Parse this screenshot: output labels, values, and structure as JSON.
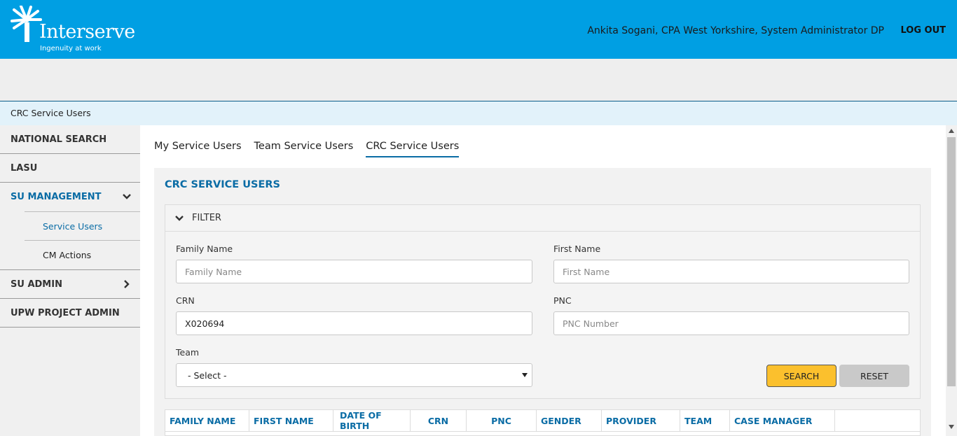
{
  "brand": {
    "name": "Interserve",
    "tagline": "Ingenuity at work"
  },
  "header": {
    "user": "Ankita Sogani, CPA West Yorkshire, System Administrator DP",
    "logout_label": "LOG OUT"
  },
  "breadcrumb": "CRC Service Users",
  "sidebar": {
    "national_search": "NATIONAL SEARCH",
    "lasu": "LASU",
    "su_management": "SU MANAGEMENT",
    "service_users": "Service Users",
    "cm_actions": "CM Actions",
    "su_admin": "SU ADMIN",
    "upw_project_admin": "UPW PROJECT ADMIN"
  },
  "tabs": {
    "my": "My Service Users",
    "team": "Team Service Users",
    "crc": "CRC Service Users"
  },
  "panel": {
    "title": "CRC SERVICE USERS",
    "filter_label": "FILTER"
  },
  "form": {
    "family_name": {
      "label": "Family Name",
      "placeholder": "Family Name",
      "value": ""
    },
    "first_name": {
      "label": "First Name",
      "placeholder": "First Name",
      "value": ""
    },
    "crn": {
      "label": "CRN",
      "placeholder": "",
      "value": "X020694"
    },
    "pnc": {
      "label": "PNC",
      "placeholder": "PNC Number",
      "value": ""
    },
    "team": {
      "label": "Team",
      "selected": "- Select -"
    },
    "search_label": "SEARCH",
    "reset_label": "RESET"
  },
  "table": {
    "columns": {
      "family_name": "FAMILY NAME",
      "first_name": "FIRST NAME",
      "dob": "DATE OF BIRTH",
      "crn": "CRN",
      "pnc": "PNC",
      "gender": "GENDER",
      "provider": "PROVIDER",
      "team": "TEAM",
      "case_manager": "CASE MANAGER"
    }
  },
  "colors": {
    "header_bg": "#009fe3",
    "accent": "#0a6ca5",
    "search_button": "#fbc02d",
    "breadcrumb_bg": "#e2f2fa"
  }
}
